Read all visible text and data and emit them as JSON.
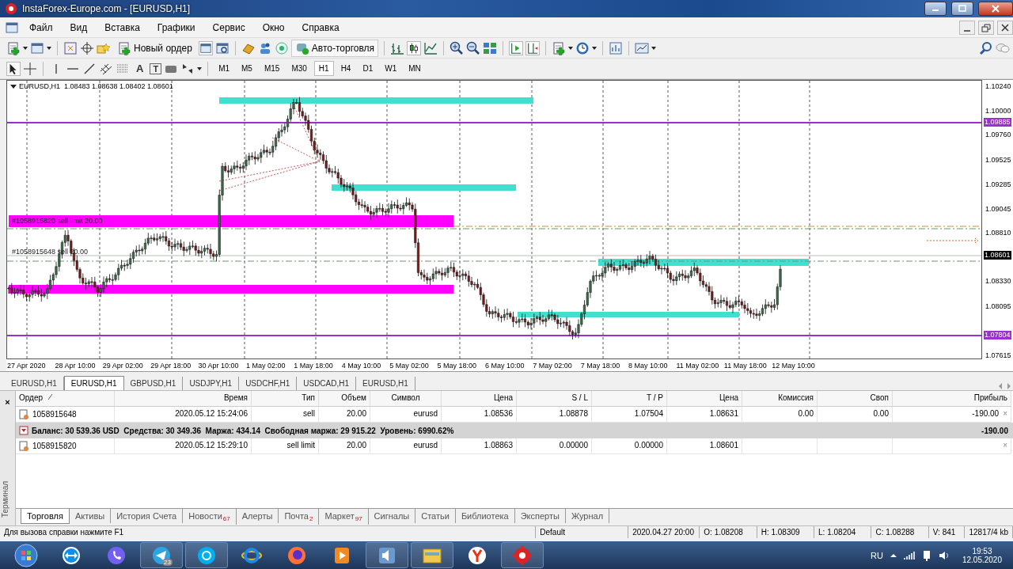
{
  "window": {
    "title": "InstaForex-Europe.com - [EURUSD,H1]"
  },
  "menu": [
    "Файл",
    "Вид",
    "Вставка",
    "Графики",
    "Сервис",
    "Окно",
    "Справка"
  ],
  "toolbar": {
    "new_order": "Новый ордер",
    "auto_trading": "Авто-торговля"
  },
  "drawing_tools": {
    "text_tool": "A",
    "label_tool": "T"
  },
  "timeframes": [
    {
      "label": "M1",
      "selected": false
    },
    {
      "label": "M5",
      "selected": false
    },
    {
      "label": "M15",
      "selected": false
    },
    {
      "label": "M30",
      "selected": false
    },
    {
      "label": "H1",
      "selected": true
    },
    {
      "label": "H4",
      "selected": false
    },
    {
      "label": "D1",
      "selected": false
    },
    {
      "label": "W1",
      "selected": false
    },
    {
      "label": "MN",
      "selected": false
    }
  ],
  "chart": {
    "header": "EURUSD,H1  1.08483 1.08638 1.08402 1.08601",
    "order_labels": [
      "#1058915820 sell limit 20.00",
      "#1058915648 sell 20.00"
    ],
    "price_ticks": [
      "1.10240",
      "1.10000",
      "1.09760",
      "1.09525",
      "1.09285",
      "1.09045",
      "1.08810",
      "1.08330",
      "1.08095",
      "1.07615"
    ],
    "price_markers": [
      {
        "text": "1.09885",
        "color": "#9b30d0"
      },
      {
        "text": "1.08601",
        "color": "#000000"
      },
      {
        "text": "1.07804",
        "color": "#9b30d0"
      }
    ],
    "time_labels": [
      "27 Apr 2020",
      "28 Apr 10:00",
      "29 Apr 02:00",
      "29 Apr 18:00",
      "30 Apr 10:00",
      "1 May 02:00",
      "1 May 18:00",
      "4 May 10:00",
      "5 May 02:00",
      "5 May 18:00",
      "6 May 10:00",
      "7 May 02:00",
      "7 May 18:00",
      "8 May 10:00",
      "11 May 02:00",
      "11 May 18:00",
      "12 May 10:00"
    ]
  },
  "chart_tabs": [
    {
      "label": "EURUSD,H1",
      "selected": false
    },
    {
      "label": "EURUSD,H1",
      "selected": true
    },
    {
      "label": "GBPUSD,H1",
      "selected": false
    },
    {
      "label": "USDJPY,H1",
      "selected": false
    },
    {
      "label": "USDCHF,H1",
      "selected": false
    },
    {
      "label": "USDCAD,H1",
      "selected": false
    },
    {
      "label": "EURUSD,H1",
      "selected": false
    }
  ],
  "terminal": {
    "title": "Терминал",
    "close": "×",
    "columns": [
      "Ордер",
      "Время",
      "Тип",
      "Объем",
      "Символ",
      "Цена",
      "S / L",
      "T / P",
      "Цена",
      "Комиссия",
      "Своп",
      "Прибыль"
    ],
    "rows": [
      {
        "kind": "order",
        "cells": [
          "1058915648",
          "2020.05.12 15:24:06",
          "sell",
          "20.00",
          "eurusd",
          "1.08536",
          "1.08878",
          "1.07504",
          "1.08631",
          "0.00",
          "0.00",
          "-190.00"
        ],
        "close": "×"
      },
      {
        "kind": "summary",
        "text": "Баланс: 30 539.36 USD  Средства: 30 349.36  Маржа: 434.14  Свободная маржа: 29 915.22  Уровень: 6990.62%",
        "profit": "-190.00"
      },
      {
        "kind": "order",
        "cells": [
          "1058915820",
          "2020.05.12 15:29:10",
          "sell limit",
          "20.00",
          "eurusd",
          "1.08863",
          "0.00000",
          "0.00000",
          "1.08601"
        ],
        "close": "×"
      }
    ],
    "tabs": [
      {
        "label": "Торговля",
        "selected": true
      },
      {
        "label": "Активы",
        "selected": false
      },
      {
        "label": "История Счета",
        "selected": false
      },
      {
        "label": "Новости",
        "badge": "67",
        "selected": false
      },
      {
        "label": "Алерты",
        "selected": false
      },
      {
        "label": "Почта",
        "badge": "2",
        "selected": false
      },
      {
        "label": "Маркет",
        "badge": "97",
        "selected": false
      },
      {
        "label": "Сигналы",
        "selected": false
      },
      {
        "label": "Статьи",
        "selected": false
      },
      {
        "label": "Библиотека",
        "selected": false
      },
      {
        "label": "Эксперты",
        "selected": false
      },
      {
        "label": "Журнал",
        "selected": false
      }
    ]
  },
  "status_bar": [
    "Для вызова справки нажмите F1",
    "Default",
    "2020.04.27 20:00",
    "O: 1.08208",
    "H: 1.08309",
    "L: 1.08204",
    "C: 1.08288",
    "V: 841",
    "12817/4 kb"
  ],
  "taskbar": {
    "telegram_badge": "23",
    "language": "RU",
    "time": "19:53",
    "date": "12.05.2020"
  }
}
